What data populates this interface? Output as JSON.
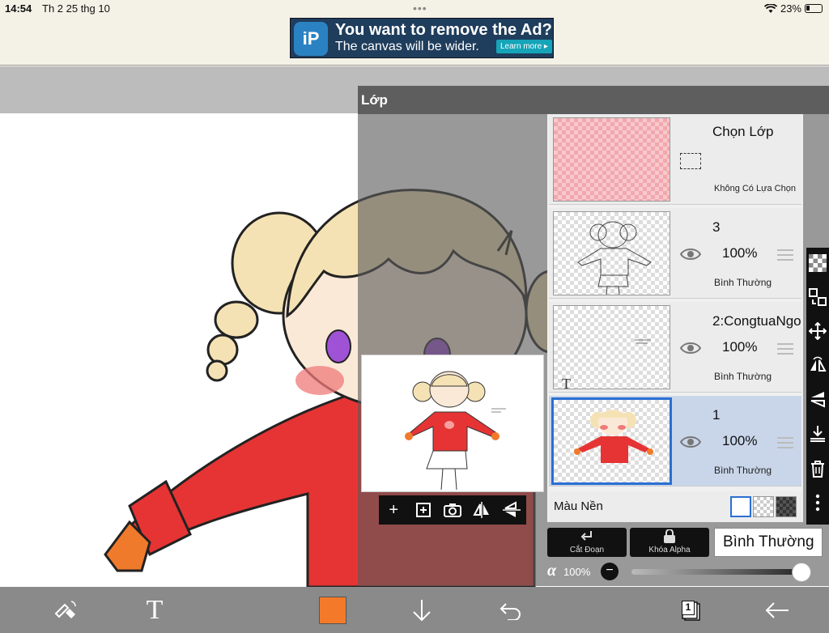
{
  "status_bar": {
    "time": "14:54",
    "date": "Th 2 25 thg 10",
    "battery": "23%"
  },
  "ad": {
    "logo": "iP",
    "title": "You want to remove the Ad?",
    "subtitle": "The canvas will be wider.",
    "cta": "Learn more ▸"
  },
  "layer_panel": {
    "title": "Lớp",
    "selection_layer": {
      "title": "Chọn Lớp",
      "subtitle": "Không Có Lựa Chọn"
    },
    "layers": [
      {
        "name": "3",
        "opacity": "100%",
        "blend": "Bình Thường"
      },
      {
        "name": "2:CongtuaNgo",
        "opacity": "100%",
        "blend": "Bình Thường"
      },
      {
        "name": "1",
        "opacity": "100%",
        "blend": "Bình Thường"
      }
    ],
    "background_label": "Màu Nền",
    "clip_label": "Cắt Đoạn",
    "alpha_lock_label": "Khóa Alpha",
    "blend_mode": "Bình Thường",
    "alpha_symbol": "α",
    "alpha_value": "100%",
    "alpha_level": 1.0,
    "alpha_minus": "−"
  },
  "bottom_toolbar": {
    "text_tool": "T",
    "layer_count": "1",
    "current_color": "#f47a2a"
  },
  "colors": {
    "panel_header": "#5e5e5e",
    "selected_layer": "#c9d6ea",
    "selected_border": "#2a6fd2",
    "toolbar": "#8a8a8a",
    "sweater": "#e63434"
  },
  "icons": {
    "eye": "eye-icon",
    "handle": "drag-handle-icon",
    "text_layer": "text-layer-icon"
  }
}
